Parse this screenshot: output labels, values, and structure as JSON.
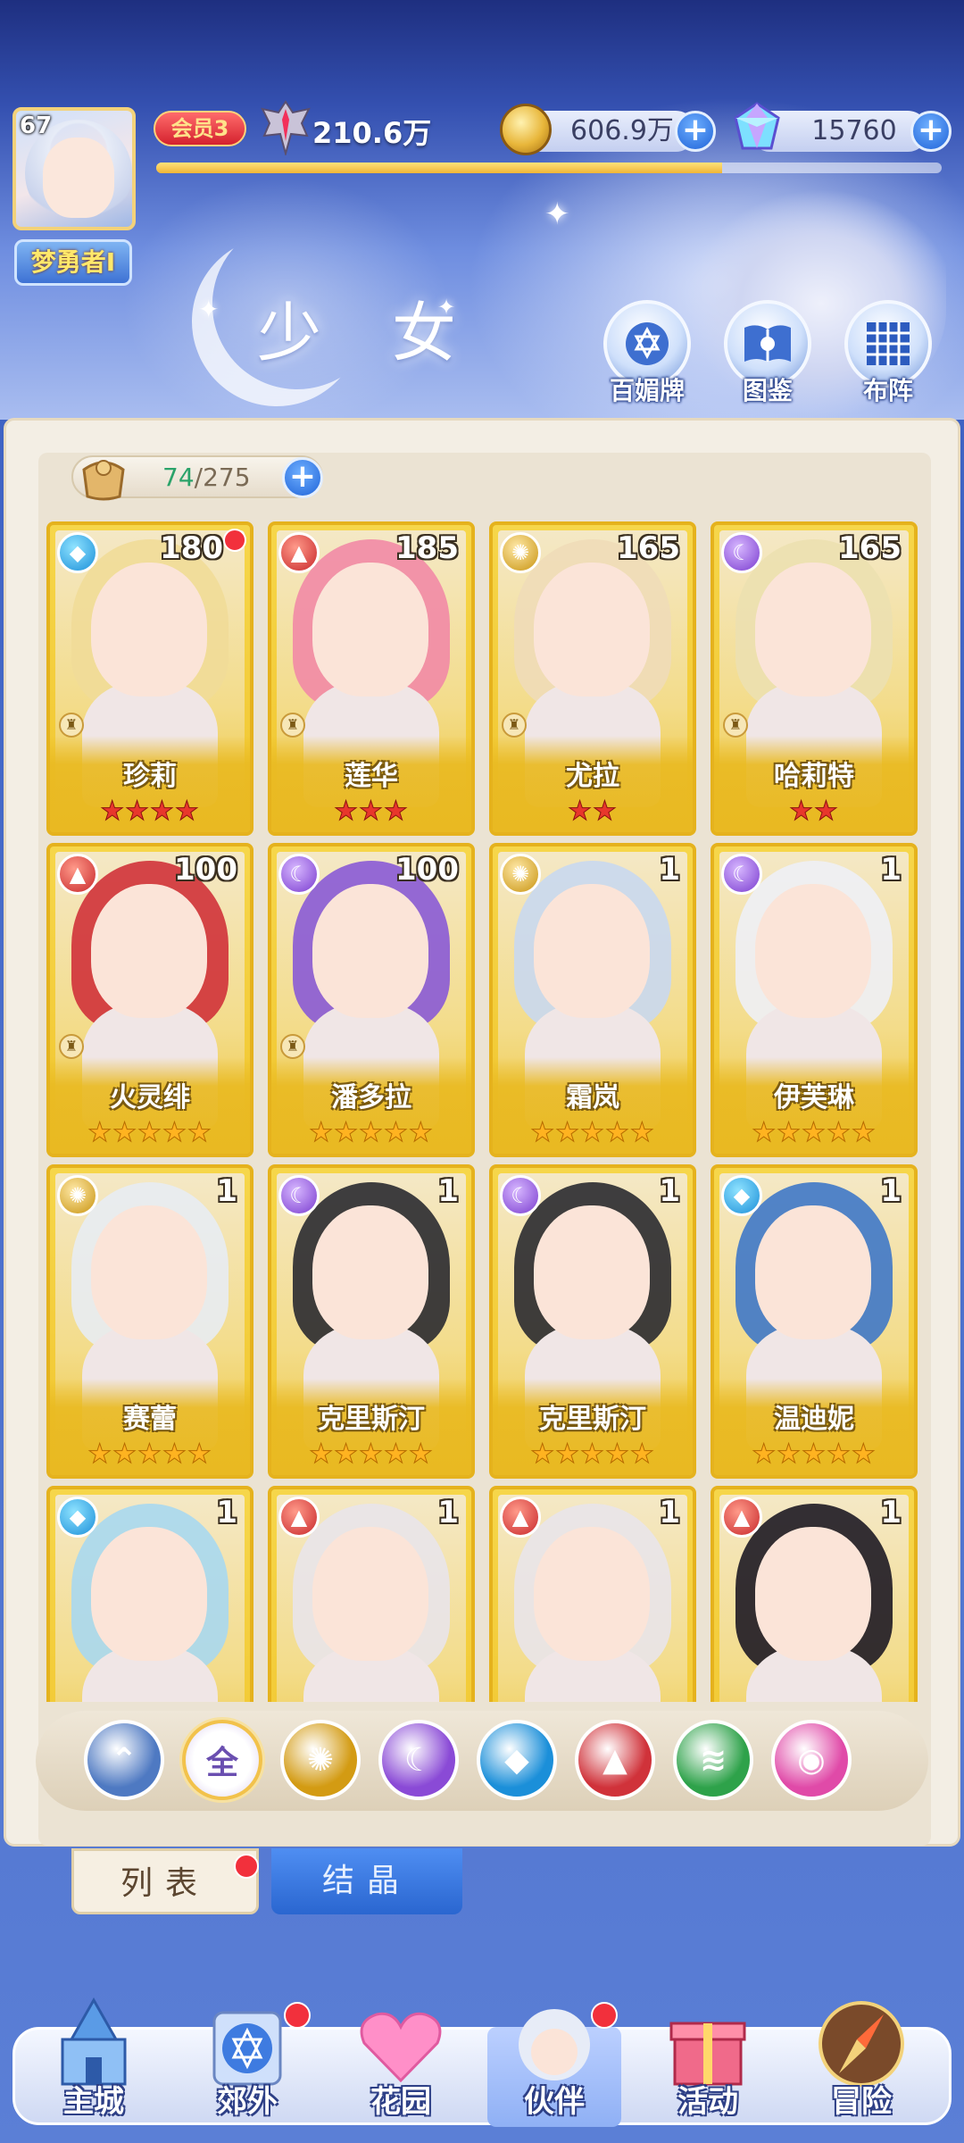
{
  "player": {
    "level": "67",
    "name": "梦勇者I",
    "vip": "会员3",
    "power": "210.6万",
    "xp_fraction": 0.72
  },
  "resources": {
    "gold": "606.9万",
    "gems": "15760"
  },
  "page_title": "少 女",
  "header_buttons": [
    {
      "label": "百媚牌",
      "icon": "card-deck-icon"
    },
    {
      "label": "图鉴",
      "icon": "book-icon"
    },
    {
      "label": "布阵",
      "icon": "formation-grid-icon"
    }
  ],
  "capacity": {
    "current": "74",
    "total": "/275"
  },
  "cards": [
    {
      "name": "珍莉",
      "level": "180",
      "element": "water",
      "stars": 4,
      "star_color": "red",
      "role_badge": true,
      "red_dot": true,
      "hair": "#f1dc98"
    },
    {
      "name": "莲华",
      "level": "185",
      "element": "fire",
      "stars": 3,
      "star_color": "red",
      "role_badge": true,
      "red_dot": false,
      "hair": "#f28aa6"
    },
    {
      "name": "尤拉",
      "level": "165",
      "element": "light",
      "stars": 2,
      "star_color": "red",
      "role_badge": true,
      "red_dot": false,
      "hair": "#efdcb8"
    },
    {
      "name": "哈莉特",
      "level": "165",
      "element": "dark",
      "stars": 2,
      "star_color": "red",
      "role_badge": true,
      "red_dot": false,
      "hair": "#ece0b0"
    },
    {
      "name": "火灵绯",
      "level": "100",
      "element": "fire",
      "stars": 5,
      "star_color": "gold",
      "role_badge": true,
      "red_dot": false,
      "hair": "#d0323a"
    },
    {
      "name": "潘多拉",
      "level": "100",
      "element": "dark",
      "stars": 5,
      "star_color": "gold",
      "role_badge": true,
      "red_dot": false,
      "hair": "#8a5ad6"
    },
    {
      "name": "霜岚",
      "level": "1",
      "element": "light",
      "stars": 5,
      "star_color": "gold",
      "role_badge": false,
      "red_dot": false,
      "hair": "#c9d8ef"
    },
    {
      "name": "伊芙琳",
      "level": "1",
      "element": "dark",
      "stars": 5,
      "star_color": "gold",
      "role_badge": false,
      "red_dot": false,
      "hair": "#eef0f6"
    },
    {
      "name": "赛蕾",
      "level": "1",
      "element": "light",
      "stars": 5,
      "star_color": "gold",
      "role_badge": false,
      "red_dot": false,
      "hair": "#e8ecf3"
    },
    {
      "name": "克里斯汀",
      "level": "1",
      "element": "dark",
      "stars": 5,
      "star_color": "gold",
      "role_badge": false,
      "red_dot": false,
      "hair": "#2a2a30"
    },
    {
      "name": "克里斯汀",
      "level": "1",
      "element": "dark",
      "stars": 5,
      "star_color": "gold",
      "role_badge": false,
      "red_dot": false,
      "hair": "#2a2a30"
    },
    {
      "name": "温迪妮",
      "level": "1",
      "element": "water",
      "stars": 5,
      "star_color": "gold",
      "role_badge": false,
      "red_dot": false,
      "hair": "#3f78c8"
    },
    {
      "name": "",
      "level": "1",
      "element": "water",
      "stars": 0,
      "star_color": "gold",
      "role_badge": false,
      "red_dot": false,
      "hair": "#a8d8f0"
    },
    {
      "name": "",
      "level": "1",
      "element": "fire",
      "stars": 0,
      "star_color": "gold",
      "role_badge": false,
      "red_dot": false,
      "hair": "#e9e4ea"
    },
    {
      "name": "",
      "level": "1",
      "element": "fire",
      "stars": 0,
      "star_color": "gold",
      "role_badge": false,
      "red_dot": false,
      "hair": "#e9e4ea"
    },
    {
      "name": "",
      "level": "1",
      "element": "fire",
      "stars": 0,
      "star_color": "gold",
      "role_badge": false,
      "red_dot": false,
      "hair": "#1e1a24"
    }
  ],
  "filters": [
    {
      "id": "class",
      "label": "",
      "icon": "class-wings-icon",
      "color": "#4e79c2",
      "active": false
    },
    {
      "id": "all",
      "label": "全",
      "icon": "all-icon",
      "color": "#ffffff",
      "active": true
    },
    {
      "id": "light",
      "label": "",
      "icon": "sun-icon",
      "color": "#d39b13",
      "active": false
    },
    {
      "id": "dark",
      "label": "",
      "icon": "moon-icon",
      "color": "#8a4ad6",
      "active": false
    },
    {
      "id": "water",
      "label": "",
      "icon": "water-drop-icon",
      "color": "#1b8fd9",
      "active": false
    },
    {
      "id": "fire",
      "label": "",
      "icon": "fire-icon",
      "color": "#d0323a",
      "active": false
    },
    {
      "id": "wind",
      "label": "",
      "icon": "tornado-icon",
      "color": "#2ea24a",
      "active": false
    },
    {
      "id": "chaos",
      "label": "",
      "icon": "orb-icon",
      "color": "#e04aa8",
      "active": false
    }
  ],
  "tabs": {
    "list": "列表",
    "crystal": "结晶"
  },
  "nav": [
    {
      "label": "主城",
      "icon": "castle-icon",
      "red_dot": false,
      "active": false
    },
    {
      "label": "郊外",
      "icon": "magic-circle-icon",
      "red_dot": true,
      "active": false
    },
    {
      "label": "花园",
      "icon": "heart-icon",
      "red_dot": false,
      "active": false
    },
    {
      "label": "伙伴",
      "icon": "companion-avatar-icon",
      "red_dot": true,
      "active": true
    },
    {
      "label": "活动",
      "icon": "gift-box-icon",
      "red_dot": false,
      "active": false
    },
    {
      "label": "冒险",
      "icon": "sword-compass-icon",
      "red_dot": false,
      "active": false
    }
  ]
}
